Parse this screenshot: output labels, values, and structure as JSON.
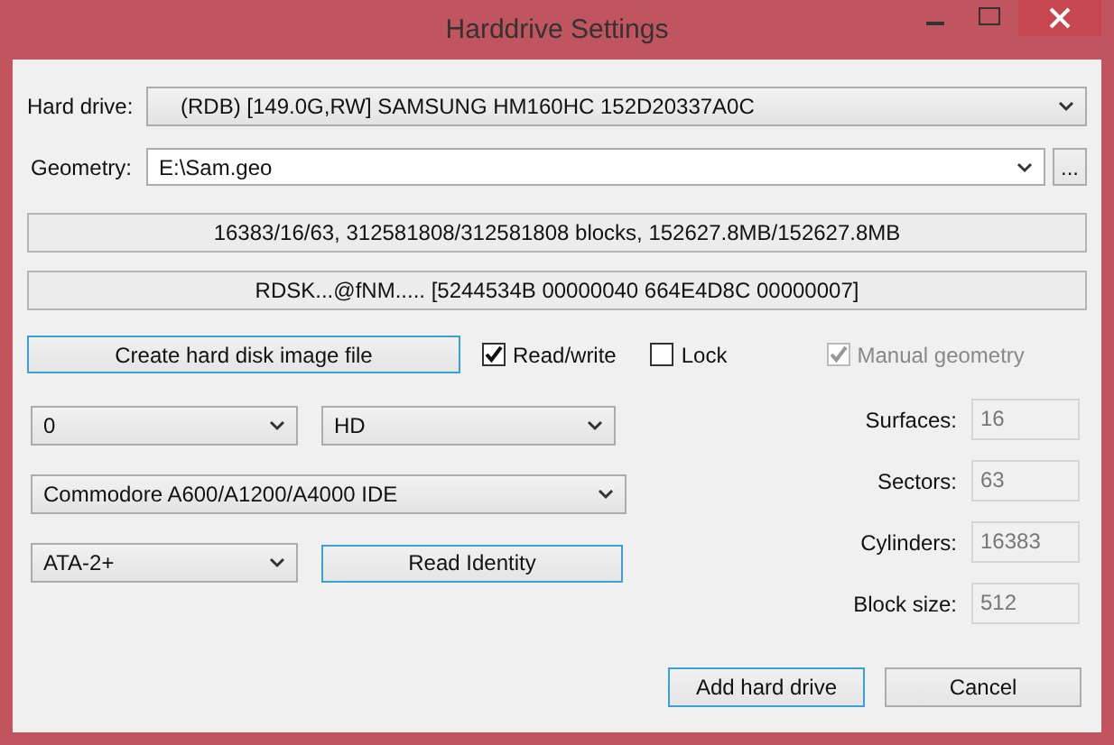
{
  "window": {
    "title": "Harddrive Settings"
  },
  "hard_drive": {
    "label": "Hard drive:",
    "value": "(RDB) [149.0G,RW] SAMSUNG HM160HC 152D20337A0C"
  },
  "geometry": {
    "label": "Geometry:",
    "value": "E:\\Sam.geo",
    "browse": "..."
  },
  "info_lines": [
    "16383/16/63, 312581808/312581808 blocks, 152627.8MB/152627.8MB",
    "RDSK...@fNM..... [5244534B 00000040 664E4D8C 00000007]"
  ],
  "create_button": {
    "label": "Create hard disk image file",
    "highlighted": true
  },
  "options": [
    {
      "label": "Read/write",
      "checked": true,
      "disabled": false
    },
    {
      "label": "Lock",
      "checked": false,
      "disabled": false
    },
    {
      "label": "Manual geometry",
      "checked": true,
      "disabled": true
    }
  ],
  "left_rows": [
    {
      "selects": [
        "0",
        "HD"
      ]
    },
    {
      "selects": [
        "Commodore A600/A1200/A4000 IDE"
      ]
    },
    {
      "selects": [
        "ATA-2+"
      ],
      "button": {
        "label": "Read Identity",
        "highlighted": true
      }
    }
  ],
  "geometry_fields": [
    {
      "label": "Surfaces:",
      "value": "16",
      "disabled": true
    },
    {
      "label": "Sectors:",
      "value": "63",
      "disabled": true
    },
    {
      "label": "Cylinders:",
      "value": "16383",
      "disabled": true
    },
    {
      "label": "Block size:",
      "value": "512",
      "disabled": true
    }
  ],
  "buttons": [
    {
      "label": "Add hard drive",
      "highlighted": true
    },
    {
      "label": "Cancel",
      "highlighted": false
    }
  ]
}
